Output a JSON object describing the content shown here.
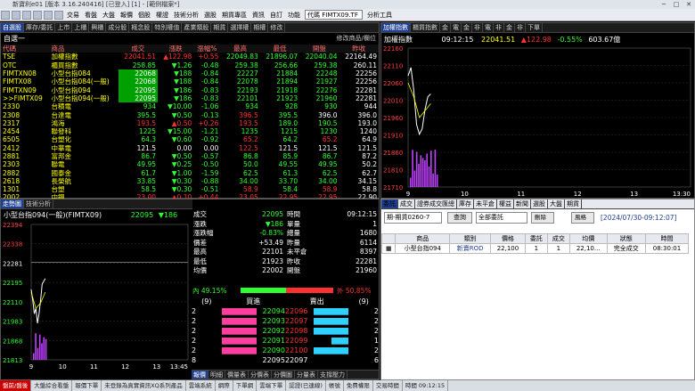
{
  "window": {
    "title": "新寶利e01 [版本 3.16.240416] [已登入] [1] - [範例檔案*]"
  },
  "toolbar": {
    "items": [
      "交易",
      "看盤",
      "大盤",
      "報價",
      "個股",
      "權證",
      "技術分析",
      "選股",
      "期貨專區",
      "資訊",
      "自訂",
      "功能"
    ],
    "symbol": "代碼 FIMTX09.TF",
    "tools": "分析工具"
  },
  "quote": {
    "tabs": [
      "自選股",
      "庫存/委託",
      "上市",
      "上櫃",
      "興櫃",
      "成分股",
      "概念股",
      "特別權值",
      "產業類股",
      "期貨",
      "選擇權",
      "期權",
      "修改"
    ],
    "group": "自選一",
    "edit": "修改商品/欄位",
    "headers": [
      "代碼",
      "商品",
      "成交",
      "漲跌",
      "漲幅%",
      "最高",
      "最低",
      "開盤",
      "昨收"
    ],
    "rows": [
      [
        "TSE",
        "加權指數",
        "22041.51",
        "▲122.98",
        "+0.55",
        "22049.83",
        "21896.07",
        "22040.04",
        "22164.49"
      ],
      [
        "OTC",
        "櫃買指數",
        "258.85",
        "▼1.26",
        "-0.48",
        "259.38",
        "256.66",
        "259.38",
        "260.11"
      ],
      [
        "FIMTXN08",
        "小型台指084",
        "22068",
        "▼188",
        "-0.84",
        "22227",
        "21884",
        "22248",
        "22256"
      ],
      [
        "FIMTX08",
        "小型台指084(一般)",
        "22068",
        "▼188",
        "-0.84",
        "22078",
        "21894",
        "21927",
        "22256"
      ],
      [
        "FIMTXN09",
        "小型台指094",
        "22095",
        "▼186",
        "-0.83",
        "22193",
        "21918",
        "22276",
        "22281"
      ],
      [
        ">>FIMTX09",
        "小型台指094(一般)",
        "22095",
        "▼186",
        "-0.83",
        "22101",
        "21923",
        "21960",
        "22281"
      ],
      [
        "2330",
        "台積電",
        "934",
        "▼10.00",
        "-1.06",
        "934",
        "928",
        "930",
        "944"
      ],
      [
        "2308",
        "台達電",
        "395.5",
        "▼0.50",
        "-0.13",
        "396.5",
        "395.5",
        "396.0",
        "396.0"
      ],
      [
        "2317",
        "鴻海",
        "193.5",
        "▲0.50",
        "+0.26",
        "193.5",
        "189.0",
        "190.5",
        "193.0"
      ],
      [
        "2454",
        "聯發科",
        "1225",
        "▼15.00",
        "-1.21",
        "1235",
        "1215",
        "1230",
        "1240"
      ],
      [
        "6505",
        "台塑化",
        "64.3",
        "▼0.60",
        "-0.92",
        "65.2",
        "64.2",
        "65.2",
        "64.9"
      ],
      [
        "2412",
        "中華電",
        "121.5",
        "0.00",
        "0.00",
        "122.5",
        "121.5",
        "121.5",
        "121.5"
      ],
      [
        "2881",
        "富邦金",
        "86.7",
        "▼0.50",
        "-0.57",
        "86.8",
        "85.9",
        "86.7",
        "87.2"
      ],
      [
        "2303",
        "聯電",
        "49.95",
        "▼0.25",
        "-0.50",
        "50.0",
        "49.55",
        "49.95",
        "50.2"
      ],
      [
        "2882",
        "國泰金",
        "61.7",
        "▼1.00",
        "-1.59",
        "62.5",
        "61.3",
        "62.5",
        "62.7"
      ],
      [
        "2618",
        "長榮航",
        "33.85",
        "▼0.30",
        "-0.88",
        "34.00",
        "33.70",
        "34.00",
        "34.15"
      ],
      [
        "1301",
        "台塑",
        "58.5",
        "▼0.30",
        "-0.51",
        "58.9",
        "58.4",
        "58.9",
        "58.8"
      ],
      [
        "2002",
        "中鋼",
        "23.00",
        "▲0.10",
        "+0.44",
        "23.05",
        "22.95",
        "22.95",
        "22.90"
      ],
      [
        "3008",
        "大立光",
        "2780",
        "▲5.00",
        "+0.18",
        "2815",
        "2770",
        "2810",
        "2775"
      ]
    ]
  },
  "index_chart": {
    "tabs": [
      "加權指數",
      "櫃買指數",
      "金",
      "電",
      "金",
      "非",
      "電",
      "非",
      "金",
      "非",
      "下單"
    ],
    "time": "09:12:15",
    "price": "22041.51",
    "change": "▲122.98",
    "pct": "-0.55%",
    "volume": "603.67億",
    "yticks": [
      "22160",
      "22110",
      "22060",
      "22010",
      "21960",
      "21910",
      "21860",
      "21810",
      "21710"
    ],
    "xticks": [
      "9",
      "10",
      "11",
      "12",
      "13",
      "13:30"
    ]
  },
  "fut": {
    "tabs": [
      "走勢圖",
      "技術分析"
    ],
    "name": "小型台指094(一般)(FIMTX09)",
    "price": "22095",
    "change": "▼186",
    "yticks": [
      "22394",
      "22338",
      "22281",
      "22195",
      "22110",
      "21983",
      "21868",
      "21813"
    ],
    "xticks": [
      "9",
      "10",
      "11",
      "12",
      "13",
      "13:45"
    ],
    "stats": [
      [
        "成交",
        "22095",
        "時間",
        "09:12:15"
      ],
      [
        "漲跌",
        "▼186",
        "單量",
        "1"
      ],
      [
        "漲跌幅",
        "-0.83%",
        "總量",
        "1680"
      ],
      [
        "價差",
        "+53.49",
        "昨量",
        "6114"
      ],
      [
        "最高",
        "22101",
        "未平倉",
        "8397"
      ],
      [
        "最低",
        "21923",
        "昨收",
        "22281"
      ],
      [
        "均價",
        "22002",
        "開盤",
        "21960"
      ]
    ],
    "inner": "內 49.15%",
    "outer": "外 50.85%",
    "book_head": [
      "(9)",
      "買進",
      "賣出",
      "(9)"
    ],
    "book": [
      [
        "2",
        "22094",
        "22096",
        "2"
      ],
      [
        "2",
        "22093",
        "22097",
        "2"
      ],
      [
        "2",
        "22092",
        "22098",
        "2"
      ],
      [
        "2",
        "22091",
        "22099",
        "1"
      ],
      [
        "2",
        "22090",
        "22100",
        "2"
      ]
    ],
    "book_total": [
      "8",
      "22095",
      "22097",
      "6"
    ],
    "bottom_tabs": [
      "報價",
      "明細",
      "價量表",
      "分價表",
      "分價圖",
      "分量表",
      "支撐壓力"
    ]
  },
  "orders": {
    "tabs": [
      "委託",
      "成交",
      "證券成交匯總",
      "庫存",
      "未平倉",
      "權益",
      "新聞",
      "選股",
      "大盤",
      "期貨"
    ],
    "account": "期-期貨0260-7",
    "query": "查詢",
    "filter": "全部委託",
    "delete": "刪除",
    "risk": "風格",
    "daterange": "[2024/07/30-09:12:07]",
    "headers": [
      "",
      "商品",
      "類別",
      "價格",
      "委託",
      "成交",
      "均價",
      "狀態",
      "時間"
    ],
    "rows": [
      [
        "■",
        "小型台指094",
        "新賣ROD",
        "22,100",
        "1",
        "1",
        "22,10...",
        "完全成交",
        "08:30:01"
      ]
    ]
  },
  "status": {
    "items": [
      "盤前/盤後",
      "大盤綜合看盤",
      "報價下單",
      "未登錄為真實資訊XQ系列產品",
      "雲端系統",
      "網際",
      "下單網",
      "雲端下單",
      "認證(已連線)",
      "帳號",
      "免費權限",
      "交易時間",
      "時間 09:12:15"
    ]
  }
}
